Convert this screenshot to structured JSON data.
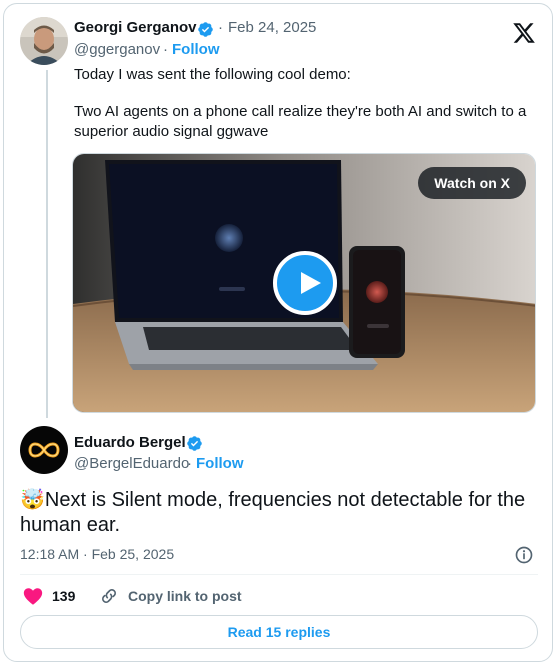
{
  "tweet": {
    "author_name": "Georgi Gerganov",
    "separator": "·",
    "date": "Feb 24, 2025",
    "handle": "@ggerganov",
    "follow_label": "Follow",
    "text_line1": "Today I was sent the following cool demo:",
    "text_line2": "Two AI agents on a phone call realize they're both AI and switch to a superior audio signal ggwave",
    "media": {
      "watch_label": "Watch on X"
    }
  },
  "reply": {
    "author_name": "Eduardo Bergel",
    "handle": "@BergelEduardo",
    "follow_label": "Follow",
    "emoji": "🤯",
    "text": "Next is Silent mode, frequencies not detectable for the human ear.",
    "timestamp": "12:18 AM · Feb 25, 2025",
    "likes": "139",
    "copy_link_label": "Copy link to post",
    "read_replies_label": "Read 15 replies"
  },
  "icons": {
    "brand": "x-logo-icon",
    "verified": "verified-badge-icon",
    "info": "info-icon",
    "heart": "heart-icon",
    "link": "link-icon",
    "play": "play-icon"
  },
  "colors": {
    "accent": "#1d9bf0",
    "heart": "#f91880",
    "text": "#0f1419",
    "muted": "#536471",
    "border": "#cfd9de"
  }
}
